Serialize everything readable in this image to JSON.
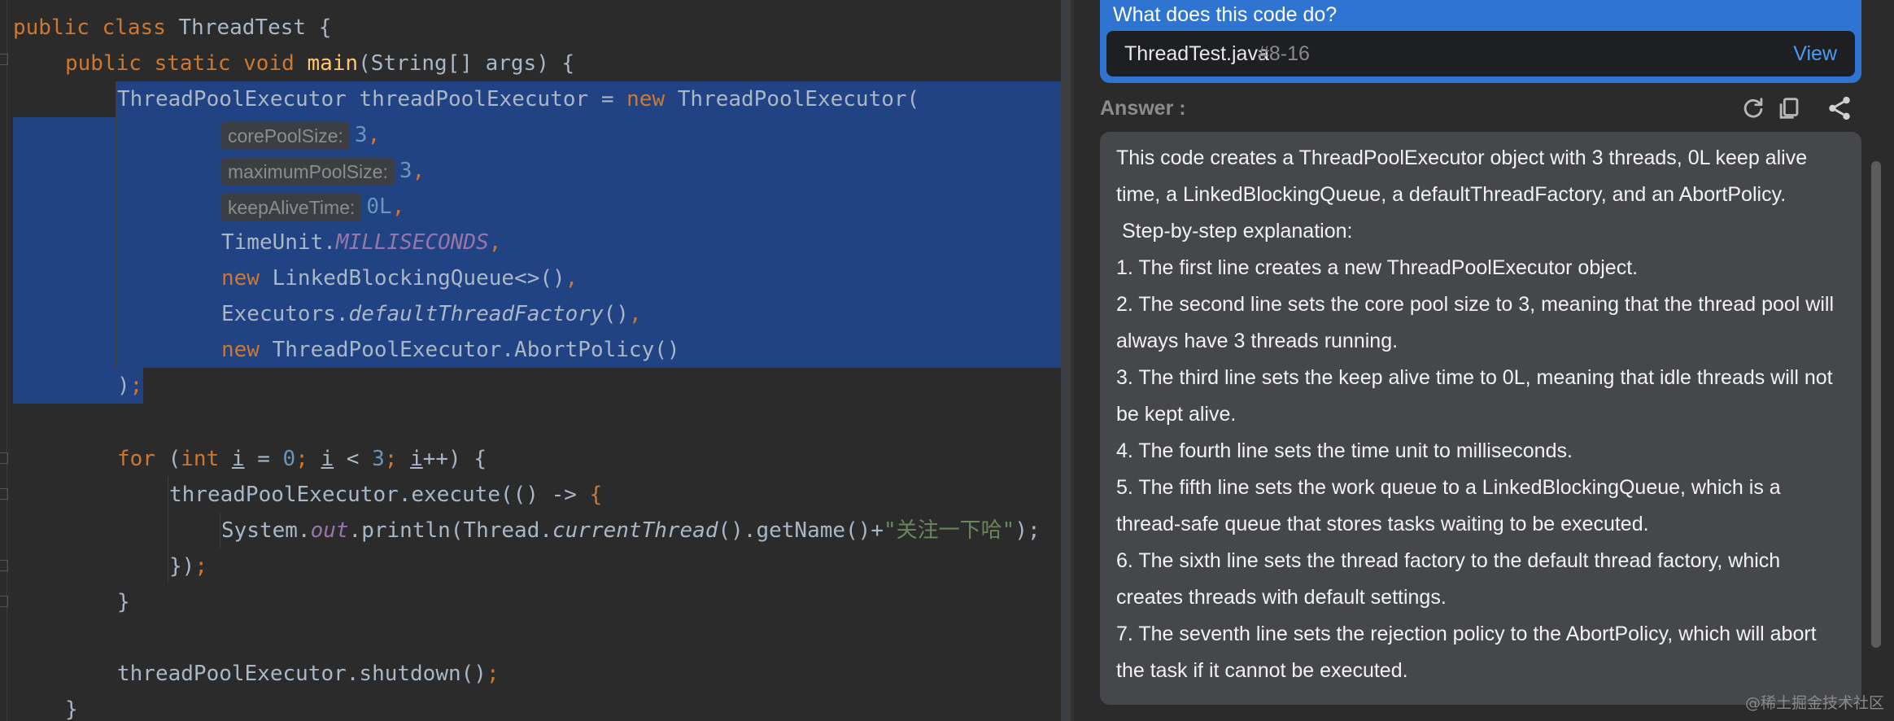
{
  "editor": {
    "lines": {
      "l1": {
        "kw1": "public",
        "kw2": "class",
        "name": "ThreadTest",
        "brace": "{"
      },
      "l2": {
        "kw1": "public",
        "kw2": "static",
        "kw3": "void",
        "fn": "main",
        "args": "(String[] args) {"
      },
      "l3": {
        "type": "ThreadPoolExecutor threadPoolExecutor = ",
        "kw": "new",
        "ctor": "ThreadPoolExecutor("
      },
      "l4": {
        "hint": "corePoolSize:",
        "num": "3",
        "comma": ","
      },
      "l5": {
        "hint": "maximumPoolSize:",
        "num": "3",
        "comma": ","
      },
      "l6": {
        "hint": "keepAliveTime:",
        "num": "0L",
        "comma": ","
      },
      "l7": {
        "cls": "TimeUnit.",
        "const": "MILLISECONDS",
        "comma": ","
      },
      "l8": {
        "kw": "new",
        "rest": "LinkedBlockingQueue<>()",
        "comma": ","
      },
      "l9": {
        "cls": "Executors.",
        "method": "defaultThreadFactory",
        "paren": "()",
        "comma": ","
      },
      "l10": {
        "kw": "new",
        "rest": "ThreadPoolExecutor.AbortPolicy()"
      },
      "l11": {
        "close": ")",
        "semi": ";"
      },
      "l13": {
        "kw": "for",
        "p1": "(",
        "kw2": "int",
        "v1": "i",
        "eq": " = ",
        "n0": "0",
        "s1": ";",
        "v2": "i",
        "lt": " < ",
        "n3": "3",
        "s2": ";",
        "v3": "i",
        "inc": "++) {"
      },
      "l14": {
        "call": "threadPoolExecutor.execute(() -> ",
        "brace": "{"
      },
      "l15": {
        "cls": "System.",
        "field": "out",
        "mid": ".println(Thread.",
        "method": "currentThread",
        "tail": "().getName()+",
        "str": "\"关注一下哈\"",
        "end": ");"
      },
      "l16": {
        "close": "})",
        "semi": ";"
      },
      "l17": {
        "brace": "}"
      },
      "l19": {
        "call": "threadPoolExecutor.shutdown()",
        "semi": ";"
      },
      "l20": {
        "brace": "}"
      }
    }
  },
  "panel": {
    "question": "What does this code do?",
    "file_name": "ThreadTest.java",
    "file_lines": "#8-16",
    "view_label": "View",
    "answer_label": "Answer :",
    "answer_lines": [
      "This code creates a ThreadPoolExecutor object with 3 threads, 0L keep alive time, a LinkedBlockingQueue, a defaultThreadFactory, and an AbortPolicy.",
      " Step-by-step explanation:",
      "1. The first line creates a new ThreadPoolExecutor object.",
      "2. The second line sets the core pool size to 3, meaning that the thread pool will always have 3 threads running.",
      "3. The third line sets the keep alive time to 0L, meaning that idle threads will not be kept alive.",
      "4. The fourth line sets the time unit to milliseconds.",
      "5. The fifth line sets the work queue to a LinkedBlockingQueue, which is a thread-safe queue that stores tasks waiting to be executed.",
      "6. The sixth line sets the thread factory to the default thread factory, which creates threads with default settings.",
      "7. The seventh line sets the rejection policy to the AbortPolicy, which will abort the task if it cannot be executed."
    ],
    "watermark": "@稀土掘金技术社区",
    "icons": [
      "refresh-icon",
      "copy-icon",
      "share-icon"
    ]
  }
}
